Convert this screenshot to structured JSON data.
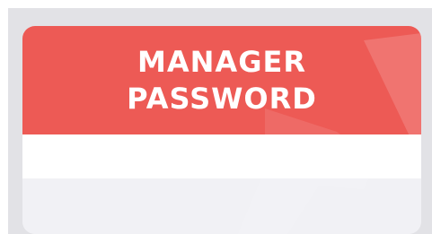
{
  "card": {
    "title_line1": "MANAGER",
    "title_line2": "PASSWORD"
  },
  "colors": {
    "header": "#ed5a55",
    "input_bar": "#ffffff",
    "card_body": "#f1f1f5",
    "frame": "#e2e2e6",
    "title_text": "#ffffff"
  },
  "icons": {
    "watermark": "logo-watermark-icon"
  }
}
